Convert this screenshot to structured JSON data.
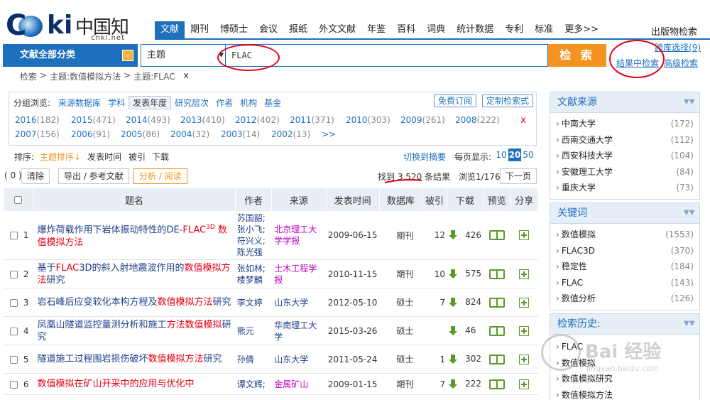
{
  "logo": {
    "text_cnki": "CNKI",
    "text_cn": "中国知网",
    "text_net": "cnki.net"
  },
  "nav": {
    "tabs": [
      "文献",
      "期刊",
      "博硕士",
      "会议",
      "报纸",
      "外文文献",
      "年鉴",
      "百科",
      "词典",
      "统计数据",
      "专利",
      "标准",
      "更多>>"
    ],
    "publication_search": "出版物检索"
  },
  "search": {
    "category_label": "文献全部分类",
    "field_label": "主题",
    "keyword": "FLAC",
    "button_label": "检 索",
    "db_select_label": "跨库选择",
    "db_select_count": "(9)",
    "in_results_label": "结果中检索",
    "advanced_label": "高级检索"
  },
  "breadcrumb": {
    "items": [
      "检索",
      ">",
      "主题:数值模拟方法",
      ">",
      "主题:FLAC"
    ],
    "close": "x"
  },
  "filter": {
    "label": "分组浏览:",
    "options": [
      "来源数据库",
      "学科",
      "发表年度",
      "研究层次",
      "作者",
      "机构",
      "基金"
    ],
    "active": "发表年度",
    "subscribe": "免费订阅",
    "custom": "定制检索式",
    "years_row1": [
      {
        "y": "2016",
        "c": "(182)"
      },
      {
        "y": "2015",
        "c": "(471)"
      },
      {
        "y": "2014",
        "c": "(493)"
      },
      {
        "y": "2013",
        "c": "(410)"
      },
      {
        "y": "2012",
        "c": "(402)"
      },
      {
        "y": "2011",
        "c": "(371)"
      },
      {
        "y": "2010",
        "c": "(303)"
      },
      {
        "y": "2009",
        "c": "(261)"
      },
      {
        "y": "2008",
        "c": "(222)"
      }
    ],
    "years_row2": [
      {
        "y": "2007",
        "c": "(156)"
      },
      {
        "y": "2006",
        "c": "(91)"
      },
      {
        "y": "2005",
        "c": "(86)"
      },
      {
        "y": "2004",
        "c": "(32)"
      },
      {
        "y": "2003",
        "c": "(14)"
      },
      {
        "y": "2002",
        "c": "(13)"
      }
    ],
    "more": ">>",
    "close": "x"
  },
  "sort": {
    "label": "排序:",
    "options": [
      "主题排序↓",
      "发表时间",
      "被引",
      "下载"
    ],
    "to_abstract": "切换到摘要",
    "per_page_label": "每页显示:",
    "per_page": [
      "10",
      "20",
      "50"
    ],
    "per_page_active": "20"
  },
  "actions": {
    "selected_count": "( 0 )",
    "clear": "清除",
    "export": "导出 / 参考文献",
    "analyze": "分析 / 阅读",
    "found_prefix": "找到",
    "found_count": "3,520",
    "found_suffix": "条结果",
    "page_info": "浏览1/176",
    "next_page": "下一页"
  },
  "table": {
    "headers": [
      "题名",
      "作者",
      "来源",
      "发表时间",
      "数据库",
      "被引",
      "下载",
      "预览",
      "分享"
    ],
    "rows": [
      {
        "n": "1",
        "title_parts": [
          [
            "爆炸荷载作用下岩体振动特性的DE-",
            false
          ],
          [
            "FLAC",
            true
          ],
          [
            "3D",
            true
          ],
          [
            " 数值模拟方法",
            true
          ]
        ],
        "authors": [
          "苏国韶;",
          "张小飞;",
          "符兴义;",
          "陈光强"
        ],
        "source": "北京理工大学学报",
        "source_pink": true,
        "date": "2009-06-15",
        "db": "期刊",
        "cite": "12",
        "dl": "426"
      },
      {
        "n": "2",
        "title_parts": [
          [
            "基于",
            false
          ],
          [
            "FLAC",
            true
          ],
          [
            "3D的斜入射地震波作用的",
            false
          ],
          [
            "数值模拟方法",
            true
          ],
          [
            "研究",
            false
          ]
        ],
        "authors": [
          "张如林;",
          "楼梦麟"
        ],
        "source": "土木工程学报",
        "source_pink": true,
        "date": "2010-11-15",
        "db": "期刊",
        "cite": "10",
        "dl": "575"
      },
      {
        "n": "3",
        "title_parts": [
          [
            "岩石峰后应变软化本构方程及",
            false
          ],
          [
            "数值模拟方法",
            true
          ],
          [
            "研究",
            false
          ]
        ],
        "authors": [
          "李文婷"
        ],
        "source": "山东大学",
        "source_pink": false,
        "date": "2012-05-10",
        "db": "硕士",
        "cite": "7",
        "dl": "824"
      },
      {
        "n": "4",
        "title_parts": [
          [
            "凤凰山隧道监控量测分析和施工",
            false
          ],
          [
            "方法数值模拟",
            true
          ],
          [
            "研究",
            false
          ]
        ],
        "authors": [
          "熊元"
        ],
        "source": "华南理工大学",
        "source_pink": false,
        "date": "2015-03-26",
        "db": "硕士",
        "cite": "",
        "dl": "46"
      },
      {
        "n": "5",
        "title_parts": [
          [
            "隧道施工过程围岩损伤破坏",
            false
          ],
          [
            "数值模拟方法",
            true
          ],
          [
            "研究",
            false
          ]
        ],
        "authors": [
          "孙倩"
        ],
        "source": "山东大学",
        "source_pink": false,
        "date": "2011-05-24",
        "db": "硕士",
        "cite": "1",
        "dl": "302"
      },
      {
        "n": "6",
        "title_parts": [
          [
            "数值模拟在矿山开采中的应用与优化中",
            true
          ]
        ],
        "authors": [
          "谭文辉;"
        ],
        "source": "金属矿山",
        "source_pink": true,
        "date": "2009-01-15",
        "db": "期刊",
        "cite": "7",
        "dl": "222"
      }
    ]
  },
  "sidebar": {
    "sources": {
      "title": "文献来源",
      "items": [
        {
          "name": "中南大学",
          "count": "(172)"
        },
        {
          "name": "西南交通大学",
          "count": "(112)"
        },
        {
          "name": "西安科技大学",
          "count": "(104)"
        },
        {
          "name": "安徽理工大学",
          "count": "(84)"
        },
        {
          "name": "重庆大学",
          "count": "(73)"
        }
      ]
    },
    "keywords": {
      "title": "关键词",
      "items": [
        {
          "name": "数值模拟",
          "count": "(1553)"
        },
        {
          "name": "FLAC3D",
          "count": "(370)"
        },
        {
          "name": "稳定性",
          "count": "(184)"
        },
        {
          "name": "FLAC",
          "count": "(143)"
        },
        {
          "name": "数值分析",
          "count": "(126)"
        }
      ]
    },
    "history": {
      "title": "检索历史:",
      "items": [
        "FLAC",
        "数值模拟",
        "数值模拟研究",
        "数值模拟方法"
      ]
    }
  },
  "watermark": {
    "text": "Bai 经验",
    "sub": "jingyan.baidu.com"
  },
  "colors": {
    "brand_blue": "#1e6fbc",
    "search_orange": "#f39422",
    "highlight_red": "#e60012",
    "source_pink": "#c000c0",
    "icon_green": "#5a9a22"
  }
}
